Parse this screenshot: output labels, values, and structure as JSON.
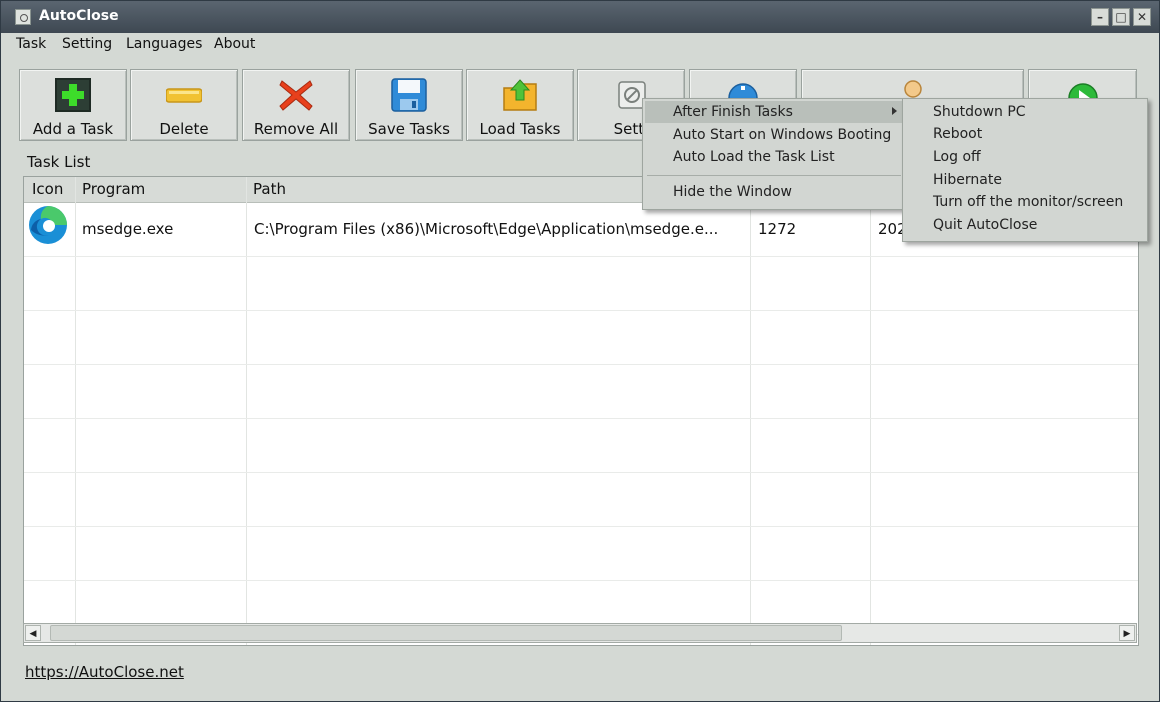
{
  "window": {
    "title": "AutoClose"
  },
  "menubar": {
    "items": [
      "Task",
      "Setting",
      "Languages",
      "About"
    ]
  },
  "toolbar": {
    "add_label": "Add a Task",
    "delete_label": "Delete",
    "remove_all_label": "Remove All",
    "save_label": "Save Tasks",
    "load_label": "Load Tasks",
    "settings_label": "Setti"
  },
  "task_list": {
    "label": "Task List",
    "columns": [
      "Icon",
      "Program",
      "Path"
    ],
    "rows": [
      {
        "program": "msedge.exe",
        "path": "C:\\Program Files (x86)\\Microsoft\\Edge\\Application\\msedge.e...",
        "pid": "1272",
        "extra": "202"
      }
    ]
  },
  "footer": {
    "link": "https://AutoClose.net"
  },
  "context_menu": {
    "items": [
      "After Finish Tasks",
      "Auto Start on Windows Booting",
      "Auto Load the Task List",
      "Hide the Window"
    ]
  },
  "submenu": {
    "items": [
      "Shutdown PC",
      "Reboot",
      "Log off",
      "Hibernate",
      "Turn off the monitor/screen",
      "Quit AutoClose"
    ]
  }
}
